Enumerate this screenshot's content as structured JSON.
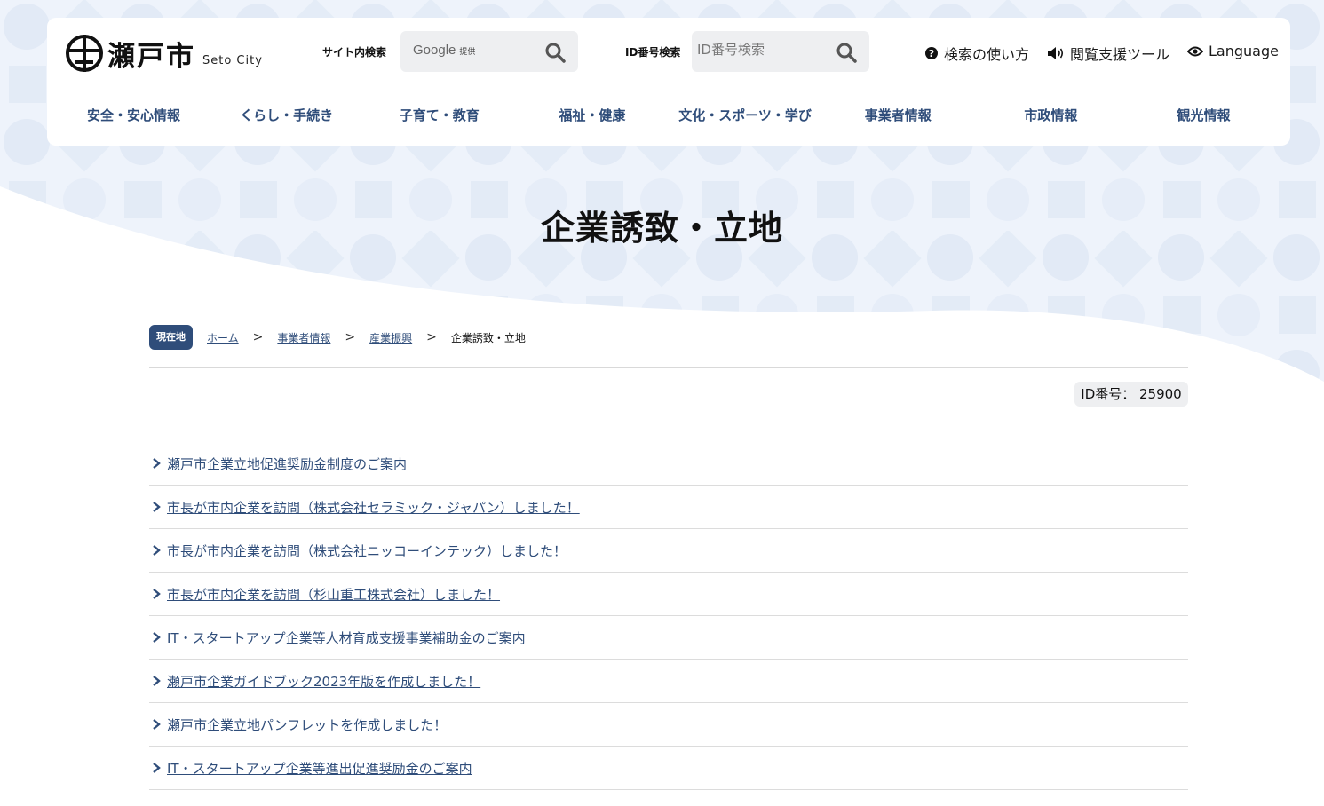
{
  "site": {
    "logo_text": "瀬戸市",
    "logo_sub": "Seto City"
  },
  "search": {
    "site_label": "サイト内検索",
    "google_label": "Google",
    "google_provided": "提供",
    "id_label": "ID番号検索",
    "id_placeholder": "ID番号検索"
  },
  "utility": {
    "help": "検索の使い方",
    "accessibility": "閲覧支援ツール",
    "language": "Language"
  },
  "gnav": [
    "安全・安心情報",
    "くらし・手続き",
    "子育て・教育",
    "福祉・健康",
    "文化・スポーツ・学び",
    "事業者情報",
    "市政情報",
    "観光情報"
  ],
  "page": {
    "title": "企業誘致・立地",
    "id_number": "ID番号： 25900"
  },
  "breadcrumb": {
    "label": "現在地",
    "items": [
      "ホーム",
      "事業者情報",
      "産業振興"
    ],
    "separator": ">",
    "current": "企業誘致・立地"
  },
  "links": [
    "瀬戸市企業立地促進奨励金制度のご案内",
    "市長が市内企業を訪問（株式会社セラミック・ジャパン）しました！",
    "市長が市内企業を訪問（株式会社ニッコーインテック）しました！",
    "市長が市内企業を訪問（杉山重工株式会社）しました！",
    "IT・スタートアップ企業等人材育成支援事業補助金のご案内",
    "瀬戸市企業ガイドブック2023年版を作成しました！",
    "瀬戸市企業立地パンフレットを作成しました！",
    "IT・スタートアップ企業等進出促進奨励金のご案内"
  ],
  "colors": {
    "accent": "#2f4d7a",
    "background_pattern": "#eef3fb",
    "search_bg": "#eeeff1"
  }
}
